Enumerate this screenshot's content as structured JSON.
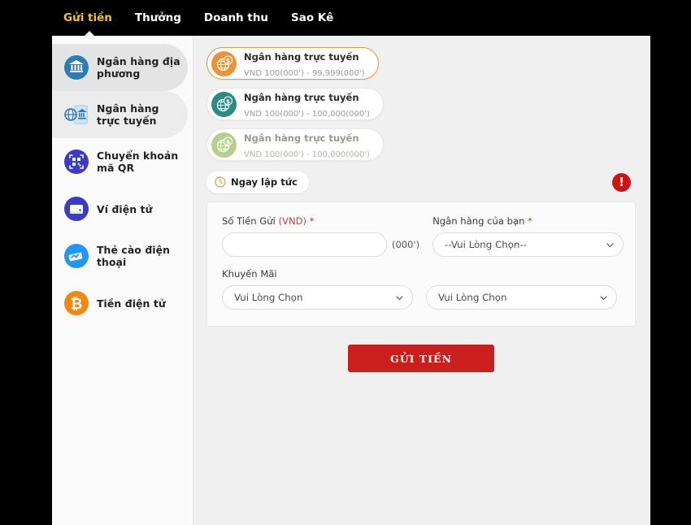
{
  "nav": {
    "tabs": [
      {
        "label": "Gửi tiền",
        "active": true
      },
      {
        "label": "Thưởng",
        "active": false
      },
      {
        "label": "Doanh thu",
        "active": false
      },
      {
        "label": "Sao Kê",
        "active": false
      }
    ]
  },
  "sidebar": {
    "items": [
      {
        "label": "Ngân hàng địa phương",
        "icon": "bank-icon",
        "state": "active"
      },
      {
        "label": "Ngân hàng trực tuyến",
        "icon": "online-bank-icon",
        "state": "active-soft"
      },
      {
        "label": "Chuyển khoản mã QR",
        "icon": "qr-code-icon",
        "state": "normal"
      },
      {
        "label": "Ví điện tử",
        "icon": "wallet-icon",
        "state": "normal"
      },
      {
        "label": "Thẻ cào điện thoại",
        "icon": "phone-card-icon",
        "state": "normal"
      },
      {
        "label": "Tiền điện tử",
        "icon": "bitcoin-icon",
        "state": "normal"
      }
    ]
  },
  "bank_options": [
    {
      "name": "Ngân hàng trực tuyến",
      "range": "VND 100(000') - 99,999(000')",
      "selected": true,
      "icon_color": "#e8943f"
    },
    {
      "name": "Ngân hàng trực tuyến",
      "range": "VND 100(000') - 100,000(000')",
      "selected": false,
      "icon_color": "#2e8b7f"
    },
    {
      "name": "Ngân hàng trực tuyến",
      "range": "VND 100(000') - 100,000(000')",
      "selected": false,
      "icon_color": "#b5cf8e"
    }
  ],
  "instant": {
    "chip_label": "Ngay lập tức",
    "chip_icon": "clock-icon",
    "warning_label": "!"
  },
  "form": {
    "amount": {
      "label_main": "Số Tiền Gửi",
      "label_currency": "(VND)",
      "required_mark": "*",
      "value": "",
      "placeholder": "",
      "unit": "(000')"
    },
    "your_bank": {
      "label": "Ngân hàng của bạn",
      "required_mark": "*",
      "value": "--Vui Lòng Chọn--"
    },
    "promotion": {
      "label": "Khuyến Mãi",
      "value": "Vui Lòng Chọn"
    },
    "promotion_second": {
      "value": "Vui Lòng Chọn"
    },
    "submit_label": "GỬI TIỀN"
  },
  "colors": {
    "accent_gold": "#f4c430",
    "submit_red": "#c9201d",
    "warning_red": "#d11215",
    "orange": "#e8943f",
    "teal": "#2e8b7f",
    "light_green": "#b5cf8e"
  }
}
